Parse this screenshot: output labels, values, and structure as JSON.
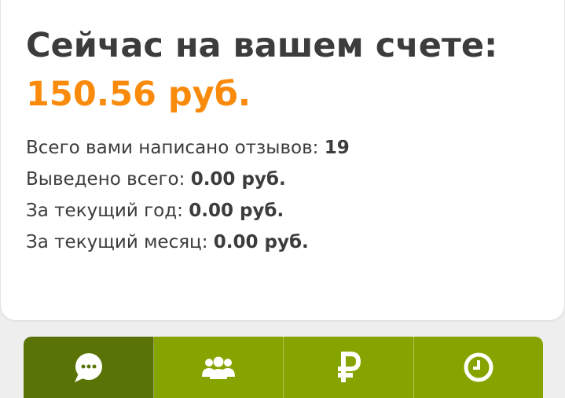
{
  "account": {
    "heading": "Сейчас на вашем счете:",
    "balance": "150.56 руб."
  },
  "stats": [
    {
      "label": "Всего вами написано отзывов: ",
      "value": "19"
    },
    {
      "label": "Выведено всего: ",
      "value": "0.00 руб."
    },
    {
      "label": "За текущий год: ",
      "value": "0.00 руб."
    },
    {
      "label": "За текущий месяц: ",
      "value": "0.00 руб."
    }
  ],
  "tabs": [
    {
      "icon": "chat-bubble-icon",
      "active": true
    },
    {
      "icon": "users-group-icon",
      "active": false
    },
    {
      "icon": "ruble-icon",
      "active": false
    },
    {
      "icon": "clock-icon",
      "active": false
    }
  ],
  "colors": {
    "balance": "#f98a0c",
    "text": "#3c3c3c",
    "tab_active": "#5a7307",
    "tab_inactive": "#86a400"
  }
}
